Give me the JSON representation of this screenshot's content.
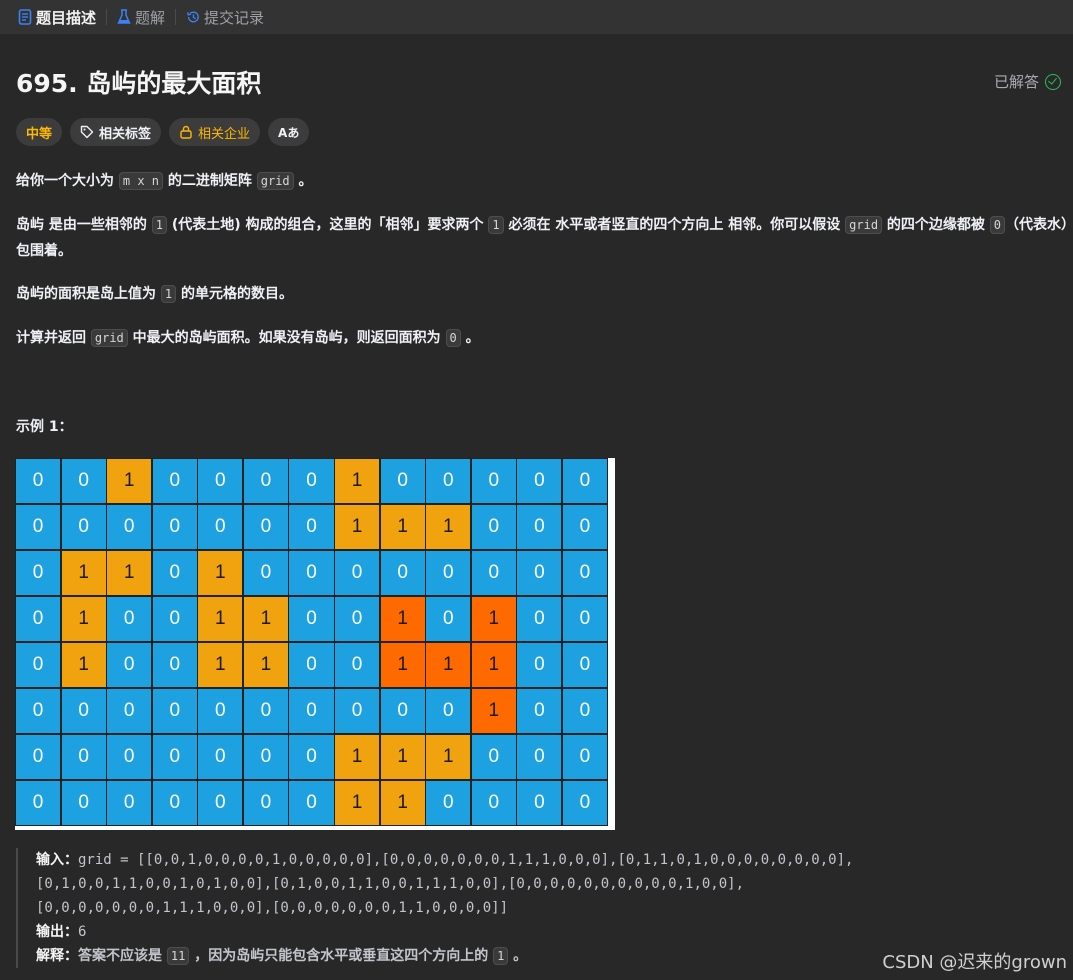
{
  "tabs": [
    {
      "label": "题目描述",
      "icon": "document-icon",
      "active": true
    },
    {
      "label": "题解",
      "icon": "flask-icon",
      "active": false
    },
    {
      "label": "提交记录",
      "icon": "history-icon",
      "active": false
    }
  ],
  "problem": {
    "title": "695. 岛屿的最大面积",
    "status": "已解答",
    "difficulty": "中等",
    "tag_related": "相关标签",
    "tag_company": "相关企业",
    "font_toggle": "Aあ"
  },
  "description": {
    "p1": {
      "a": "给你一个大小为 ",
      "code1": "m x n",
      "b": " 的二进制矩阵 ",
      "code2": "grid",
      "c": " 。"
    },
    "p2": {
      "a": "岛屿",
      "b": " 是由一些相邻的 ",
      "code1": "1",
      "c": " (代表土地) 构成的组合，这里的「相邻」要求两个 ",
      "code2": "1",
      "d": " 必须在 ",
      "e": "水平或者竖直的四个方向上",
      "f": " 相邻。你可以假设 ",
      "code3": "grid",
      "g": " 的四个边缘都被 ",
      "code4": "0",
      "h": "（代表水）包围着。"
    },
    "p3": {
      "a": "岛屿的面积是岛上值为 ",
      "code1": "1",
      "b": " 的单元格的数目。"
    },
    "p4": {
      "a": "计算并返回 ",
      "code1": "grid",
      "b": " 中最大的岛屿面积。如果没有岛屿，则返回面积为 ",
      "code2": "0",
      "c": " 。"
    }
  },
  "example": {
    "heading": "示例 1：",
    "input_label": "输入：",
    "input_line1": "grid = [[0,0,1,0,0,0,0,1,0,0,0,0,0],[0,0,0,0,0,0,0,1,1,1,0,0,0],[0,1,1,0,1,0,0,0,0,0,0,0,0],",
    "input_line2": "[0,1,0,0,1,1,0,0,1,0,1,0,0],[0,1,0,0,1,1,0,0,1,1,1,0,0],[0,0,0,0,0,0,0,0,0,0,1,0,0],",
    "input_line3": "[0,0,0,0,0,0,0,1,1,1,0,0,0],[0,0,0,0,0,0,0,1,1,0,0,0,0]]",
    "output_label": "输出：",
    "output_value": "6",
    "explain_label": "解释：",
    "explain_a": "答案不应该是 ",
    "explain_code": "11",
    "explain_b": " ，因为岛屿只能包含水平或垂直这四个方向上的 ",
    "explain_code2": "1",
    "explain_c": " 。"
  },
  "grid_values": [
    [
      0,
      0,
      1,
      0,
      0,
      0,
      0,
      1,
      0,
      0,
      0,
      0,
      0
    ],
    [
      0,
      0,
      0,
      0,
      0,
      0,
      0,
      1,
      1,
      1,
      0,
      0,
      0
    ],
    [
      0,
      1,
      1,
      0,
      1,
      0,
      0,
      0,
      0,
      0,
      0,
      0,
      0
    ],
    [
      0,
      1,
      0,
      0,
      1,
      1,
      0,
      0,
      1,
      0,
      1,
      0,
      0
    ],
    [
      0,
      1,
      0,
      0,
      1,
      1,
      0,
      0,
      1,
      1,
      1,
      0,
      0
    ],
    [
      0,
      0,
      0,
      0,
      0,
      0,
      0,
      0,
      0,
      0,
      1,
      0,
      0
    ],
    [
      0,
      0,
      0,
      0,
      0,
      0,
      0,
      1,
      1,
      1,
      0,
      0,
      0
    ],
    [
      0,
      0,
      0,
      0,
      0,
      0,
      0,
      1,
      1,
      0,
      0,
      0,
      0
    ]
  ],
  "grid_highlight": [
    [
      3,
      8
    ],
    [
      3,
      10
    ],
    [
      4,
      8
    ],
    [
      4,
      9
    ],
    [
      4,
      10
    ],
    [
      5,
      10
    ]
  ],
  "colors": {
    "water": "#1ea1e1",
    "land": "#f0a20f",
    "largest_island": "#ff6a00",
    "difficulty": "#ffb800",
    "solved": "#2cbb5d"
  },
  "watermark": "CSDN @迟来的grown"
}
